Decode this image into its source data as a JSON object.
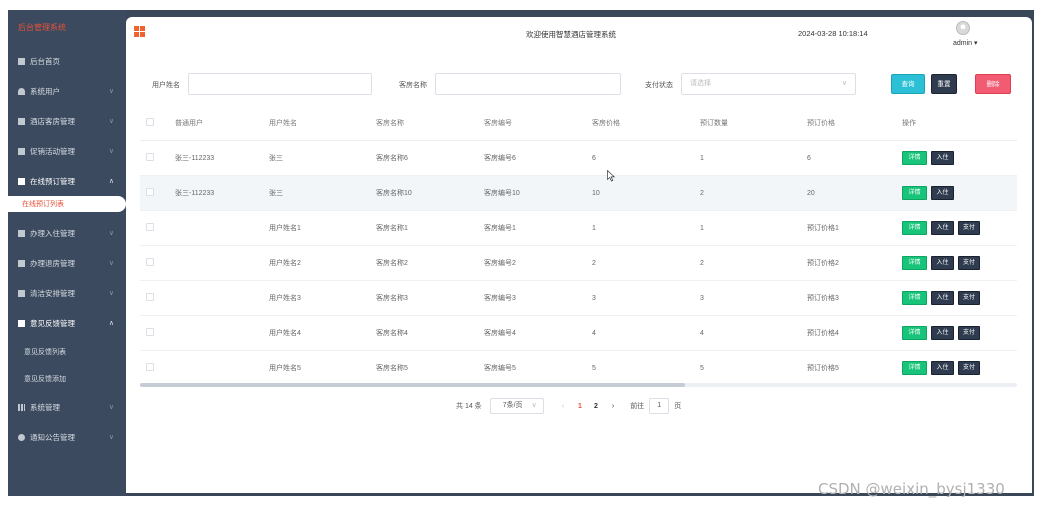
{
  "app": {
    "brand": "后台管理系统",
    "welcome": "欢迎使用智慧酒店管理系统",
    "datetime": "2024-03-28 10:18:14",
    "user": "admin ▾"
  },
  "sidebar": {
    "items": [
      {
        "label": "后台首页",
        "chevron": ""
      },
      {
        "label": "系统用户",
        "chevron": "∨"
      },
      {
        "label": "酒店客房管理",
        "chevron": "∨"
      },
      {
        "label": "促销活动管理",
        "chevron": "∨"
      },
      {
        "label": "在线预订管理",
        "chevron": "∧"
      },
      {
        "label": "办理入住管理",
        "chevron": "∨"
      },
      {
        "label": "办理退房管理",
        "chevron": "∨"
      },
      {
        "label": "清洁安排管理",
        "chevron": "∨"
      },
      {
        "label": "意见反馈管理",
        "chevron": "∧"
      },
      {
        "label": "系统管理",
        "chevron": "∨"
      },
      {
        "label": "通知公告管理",
        "chevron": "∨"
      }
    ],
    "sub_active": "在线预订列表",
    "feedback_subs": [
      "意见反馈列表",
      "意见反馈添加"
    ]
  },
  "search": {
    "username_label": "用户姓名",
    "room_label": "客房名称",
    "pay_label": "支付状态",
    "pay_placeholder": "请选择",
    "arrow": "∨",
    "query": "查询",
    "reset": "重置",
    "delete": "删除"
  },
  "table": {
    "headers": [
      "普通用户",
      "用户姓名",
      "客房名称",
      "客房编号",
      "客房价格",
      "预订数量",
      "预订价格",
      "操作"
    ],
    "rows": [
      {
        "user": "张三-112233",
        "name": "张三",
        "room": "客房名称6",
        "code": "客房编号6",
        "price": "6",
        "count": "1",
        "oprice": "6",
        "pay": false
      },
      {
        "user": "张三-112233",
        "name": "张三",
        "room": "客房名称10",
        "code": "客房编号10",
        "price": "10",
        "count": "2",
        "oprice": "20",
        "pay": false
      },
      {
        "user": "",
        "name": "用户姓名1",
        "room": "客房名称1",
        "code": "客房编号1",
        "price": "1",
        "count": "1",
        "oprice": "预订价格1",
        "pay": true
      },
      {
        "user": "",
        "name": "用户姓名2",
        "room": "客房名称2",
        "code": "客房编号2",
        "price": "2",
        "count": "2",
        "oprice": "预订价格2",
        "pay": true
      },
      {
        "user": "",
        "name": "用户姓名3",
        "room": "客房名称3",
        "code": "客房编号3",
        "price": "3",
        "count": "3",
        "oprice": "预订价格3",
        "pay": true
      },
      {
        "user": "",
        "name": "用户姓名4",
        "room": "客房名称4",
        "code": "客房编号4",
        "price": "4",
        "count": "4",
        "oprice": "预订价格4",
        "pay": true
      },
      {
        "user": "",
        "name": "用户姓名5",
        "room": "客房名称5",
        "code": "客房编号5",
        "price": "5",
        "count": "5",
        "oprice": "预订价格5",
        "pay": true
      }
    ],
    "btn_detail": "详情",
    "btn_checkin": "入住",
    "btn_pay": "支付"
  },
  "pager": {
    "total": "共 14 条",
    "size": "7条/页",
    "arrow": "∨",
    "prev": "‹",
    "next": "›",
    "pages": [
      "1",
      "2"
    ],
    "goto_label": "前往",
    "goto_value": "1",
    "goto_unit": "页"
  },
  "watermark": "CSDN @weixin_bysj1330"
}
